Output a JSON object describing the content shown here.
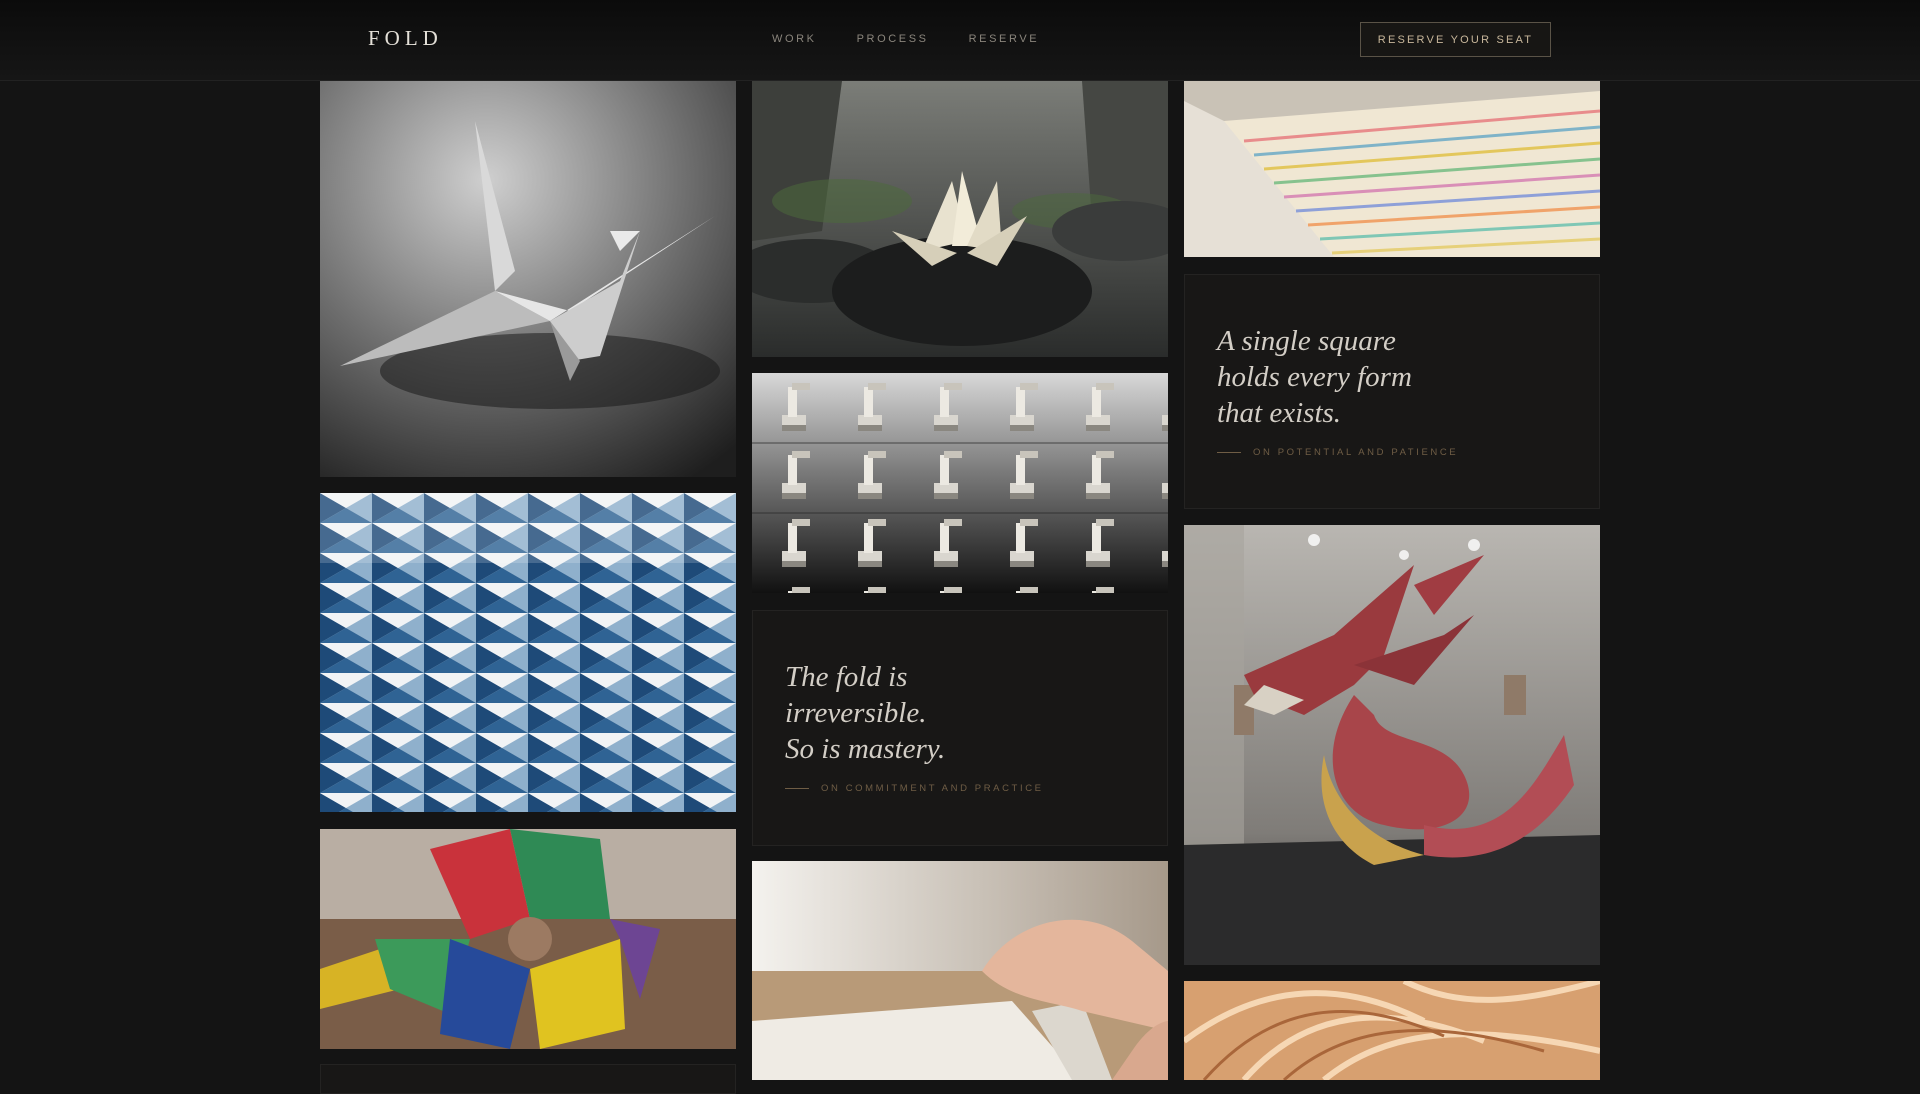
{
  "header": {
    "logo": "FOLD",
    "nav": [
      "WORK",
      "PROCESS",
      "RESERVE"
    ],
    "cta_label": "RESERVE YOUR SEAT"
  },
  "gallery": {
    "images": [
      {
        "name": "crane-photo",
        "icon": "origami-crane"
      },
      {
        "name": "tessellation-photo",
        "icon": "blue-white-tessellation"
      },
      {
        "name": "modular-photo",
        "icon": "colorful-modular-origami"
      },
      {
        "name": "lotus-photo",
        "icon": "paper-lotus-on-stone"
      },
      {
        "name": "robot-arms-photo",
        "icon": "robotic-folding-arms"
      },
      {
        "name": "hands-folding-photo",
        "icon": "hands-folding-paper"
      },
      {
        "name": "paper-stack-photo",
        "icon": "stacked-colored-paper"
      },
      {
        "name": "dragon-photo",
        "icon": "red-paper-dragon"
      },
      {
        "name": "curved-folds-photo",
        "icon": "copper-curved-folds"
      }
    ]
  },
  "quotes": [
    {
      "text": "A single square\nholds every form\nthat exists.",
      "caption": "ON POTENTIAL AND PATIENCE"
    },
    {
      "text": "The fold is\nirreversible.\nSo is mastery.",
      "caption": "ON COMMITMENT AND PRACTICE"
    }
  ],
  "colors": {
    "background": "#141414",
    "card": "#181716",
    "accent": "#c8b79b",
    "caption": "#6f5d45"
  }
}
